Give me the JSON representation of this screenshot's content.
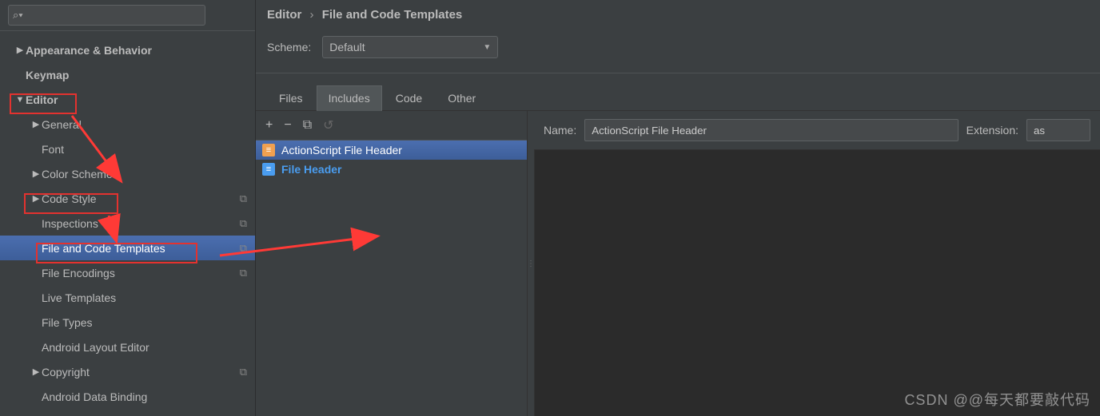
{
  "breadcrumb": {
    "root": "Editor",
    "page": "File and Code Templates"
  },
  "scheme": {
    "label": "Scheme:",
    "value": "Default"
  },
  "tabs": [
    "Files",
    "Includes",
    "Code",
    "Other"
  ],
  "active_tab": "Includes",
  "toolbar": {
    "add": "+",
    "remove": "−",
    "copy": "⧉",
    "undo": "↺"
  },
  "files": [
    {
      "name": "ActionScript File Header",
      "selected": true,
      "icon": "orange"
    },
    {
      "name": "File Header",
      "selected": false,
      "icon": "blue",
      "bold": true
    }
  ],
  "detail": {
    "name_label": "Name:",
    "name_value": "ActionScript File Header",
    "ext_label": "Extension:",
    "ext_value": "as"
  },
  "sidebar": {
    "items": [
      {
        "label": "Appearance & Behavior",
        "depth": 0,
        "exp": "▶",
        "bold": true
      },
      {
        "label": "Keymap",
        "depth": 0,
        "exp": "",
        "bold": true
      },
      {
        "label": "Editor",
        "depth": 0,
        "exp": "▼",
        "bold": true,
        "hl": true
      },
      {
        "label": "General",
        "depth": 1,
        "exp": "▶"
      },
      {
        "label": "Font",
        "depth": 1,
        "exp": ""
      },
      {
        "label": "Color Scheme",
        "depth": 1,
        "exp": "▶"
      },
      {
        "label": "Code Style",
        "depth": 1,
        "exp": "▶",
        "trail": "⧉",
        "hl": true
      },
      {
        "label": "Inspections",
        "depth": 1,
        "exp": "",
        "trail": "⧉"
      },
      {
        "label": "File and Code Templates",
        "depth": 1,
        "exp": "",
        "trail": "⧉",
        "sel": true,
        "hl": true
      },
      {
        "label": "File Encodings",
        "depth": 1,
        "exp": "",
        "trail": "⧉"
      },
      {
        "label": "Live Templates",
        "depth": 1,
        "exp": ""
      },
      {
        "label": "File Types",
        "depth": 1,
        "exp": ""
      },
      {
        "label": "Android Layout Editor",
        "depth": 1,
        "exp": ""
      },
      {
        "label": "Copyright",
        "depth": 1,
        "exp": "▶",
        "trail": "⧉"
      },
      {
        "label": "Android Data Binding",
        "depth": 1,
        "exp": ""
      }
    ]
  },
  "watermark": "CSDN @@每天都要敲代码"
}
